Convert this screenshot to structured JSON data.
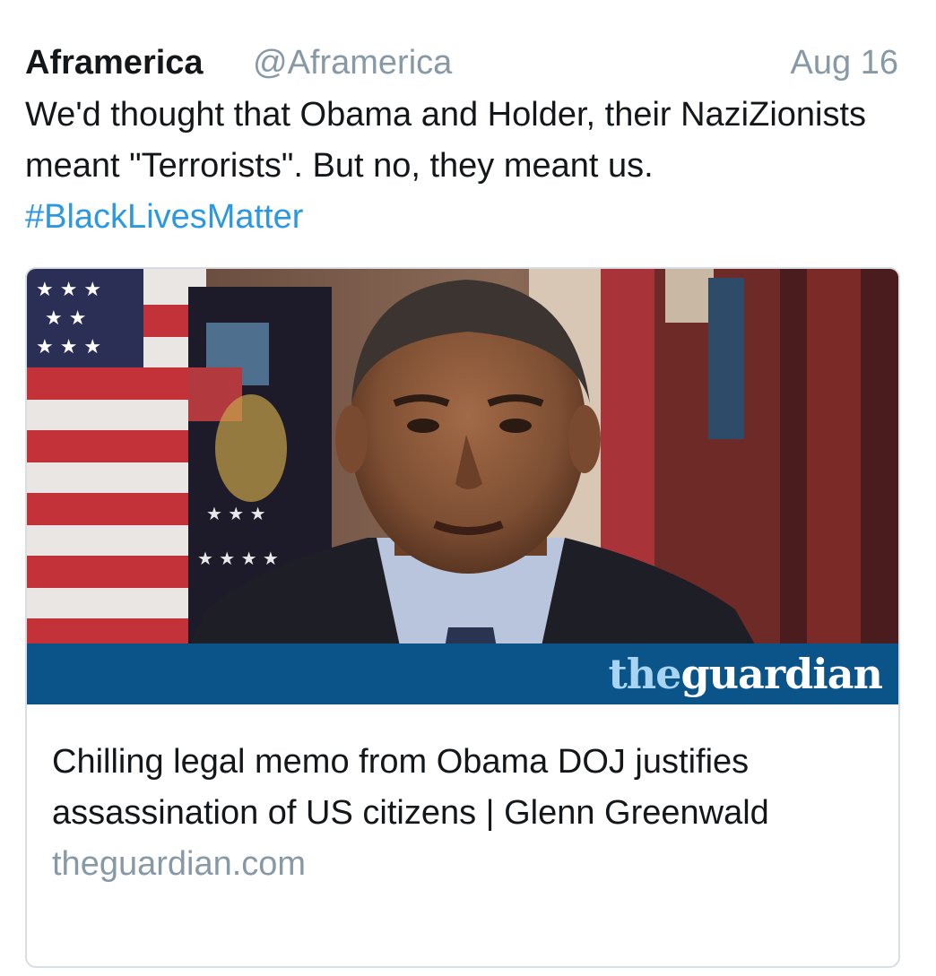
{
  "tweet": {
    "display_name": "Aframerica",
    "handle": "@Aframerica",
    "timestamp": "Aug 16",
    "text_main": "We'd thought that Obama and Holder, their NaziZionists meant \"Terrorists\". But no, they meant us. ",
    "hashtag": "#BlackLivesMatter"
  },
  "card": {
    "logo_the": "the",
    "logo_guardian": "guardian",
    "title": "Chilling legal memo from Obama DOJ justifies assassination of US citizens | Glenn Greenwald",
    "domain": "theguardian.com"
  },
  "colors": {
    "link": "#2b98e0",
    "secondary_text": "#8899a6",
    "guardian_blue": "#0a5489"
  }
}
